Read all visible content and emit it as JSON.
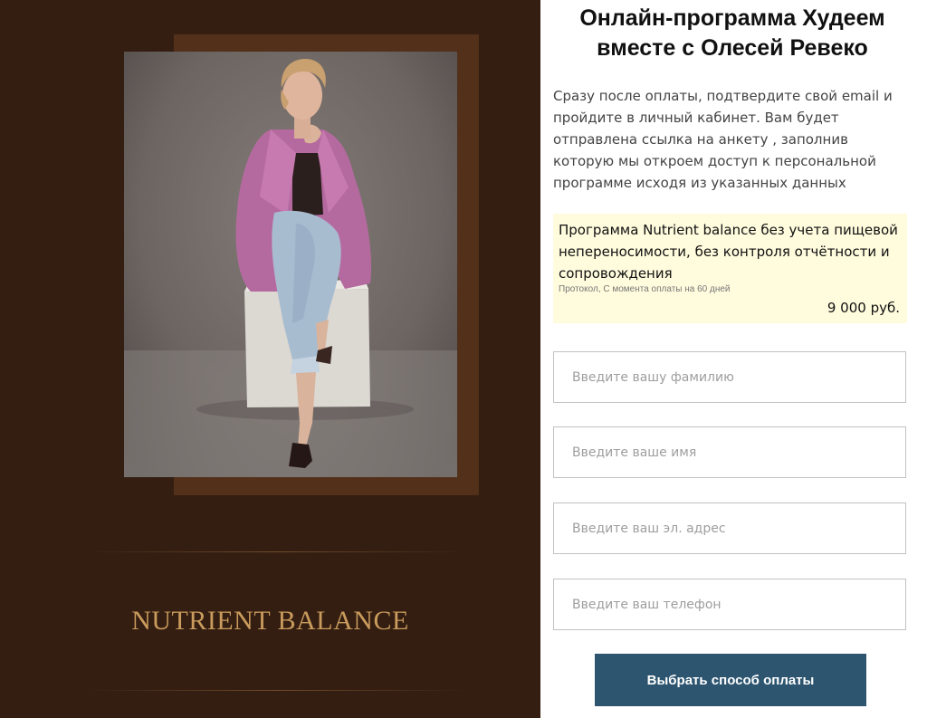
{
  "brand": {
    "name": "NUTRIENT BALANCE",
    "text_color": "#c99b5c",
    "background": "#341e12",
    "frame_color": "#52301a"
  },
  "hero_image": {
    "icon": "portrait-photo",
    "subject": "woman in pink blazer and jeans sitting on white cube"
  },
  "order": {
    "title": "Онлайн-программа Худеем вместе с Олесей Ревеко",
    "description": "Сразу после оплаты, подтвердите свой email и пройдите в личный кабинет. Вам будет отправлена ссылка на анкету , заполнив которую мы откроем доступ к персональной программе исходя из указанных данных",
    "product": {
      "name": "Программа Nutrient balance без учета пищевой непереносимости, без контроля отчётности и сопровождения",
      "subtitle": "Протокол, С момента оплаты на 60 дней",
      "price": "9 000 руб.",
      "background": "#fffbdd"
    },
    "fields": {
      "surname_placeholder": "Введите вашу фамилию",
      "name_placeholder": "Введите ваше имя",
      "email_placeholder": "Введите ваш эл. адрес",
      "phone_placeholder": "Введите ваш телефон"
    },
    "submit_label": "Выбрать способ оплаты",
    "submit_color": "#2d5570"
  }
}
